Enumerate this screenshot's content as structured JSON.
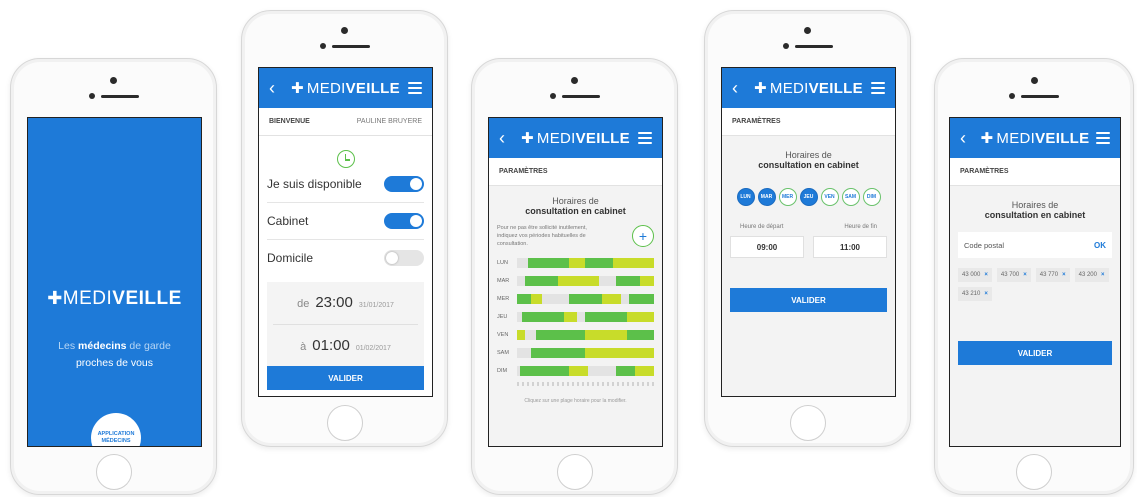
{
  "brand": {
    "prefix": "MEDI",
    "suffix": "VEILLE"
  },
  "splash": {
    "tagline_1": "Les",
    "tagline_2": "médecins",
    "tagline_3": "de garde",
    "tagline_4": "proches de vous",
    "badge_line1": "APPLICATION",
    "badge_line2": "MÉDECINS"
  },
  "availability": {
    "welcome": "BIENVENUE",
    "user": "PAULINE BRUYERE",
    "available_label": "Je suis disponible",
    "cabinet_label": "Cabinet",
    "domicile_label": "Domicile",
    "from_prefix": "de",
    "from_time": "23:00",
    "from_date": "31/01/2017",
    "to_prefix": "à",
    "to_time": "01:00",
    "to_date": "01/02/2017",
    "validate": "VALIDER"
  },
  "schedule": {
    "section": "PARAMÈTRES",
    "title_1": "Horaires de",
    "title_2": "consultation en cabinet",
    "help": "Pour ne pas être sollicité inutilement, indiquez vos périodes habituelles de consultation.",
    "days": [
      "LUN",
      "MAR",
      "MER",
      "JEU",
      "VEN",
      "SAM",
      "DIM"
    ],
    "hint": "Cliquez sur une plage horaire pour la modifier."
  },
  "hours": {
    "section": "PARAMÈTRES",
    "title_1": "Horaires de",
    "title_2": "consultation en cabinet",
    "days": [
      {
        "label": "LUN",
        "on": true
      },
      {
        "label": "MAR",
        "on": true
      },
      {
        "label": "MER",
        "on": false
      },
      {
        "label": "JEU",
        "on": true
      },
      {
        "label": "VEN",
        "on": false
      },
      {
        "label": "SAM",
        "on": false
      },
      {
        "label": "DIM",
        "on": false
      }
    ],
    "start_label": "Heure de départ",
    "end_label": "Heure de fin",
    "start_value": "09:00",
    "end_value": "11:00",
    "validate": "VALIDER"
  },
  "postal": {
    "section": "PARAMÈTRES",
    "title_1": "Horaires de",
    "title_2": "consultation en cabinet",
    "placeholder": "Code postal",
    "ok": "OK",
    "codes": [
      "43 000",
      "43 700",
      "43 770",
      "43 200",
      "43 210"
    ],
    "validate": "VALIDER"
  },
  "colors": {
    "primary": "#1e7ad8",
    "green": "#5cc04a",
    "lime": "#c8dc2a"
  }
}
